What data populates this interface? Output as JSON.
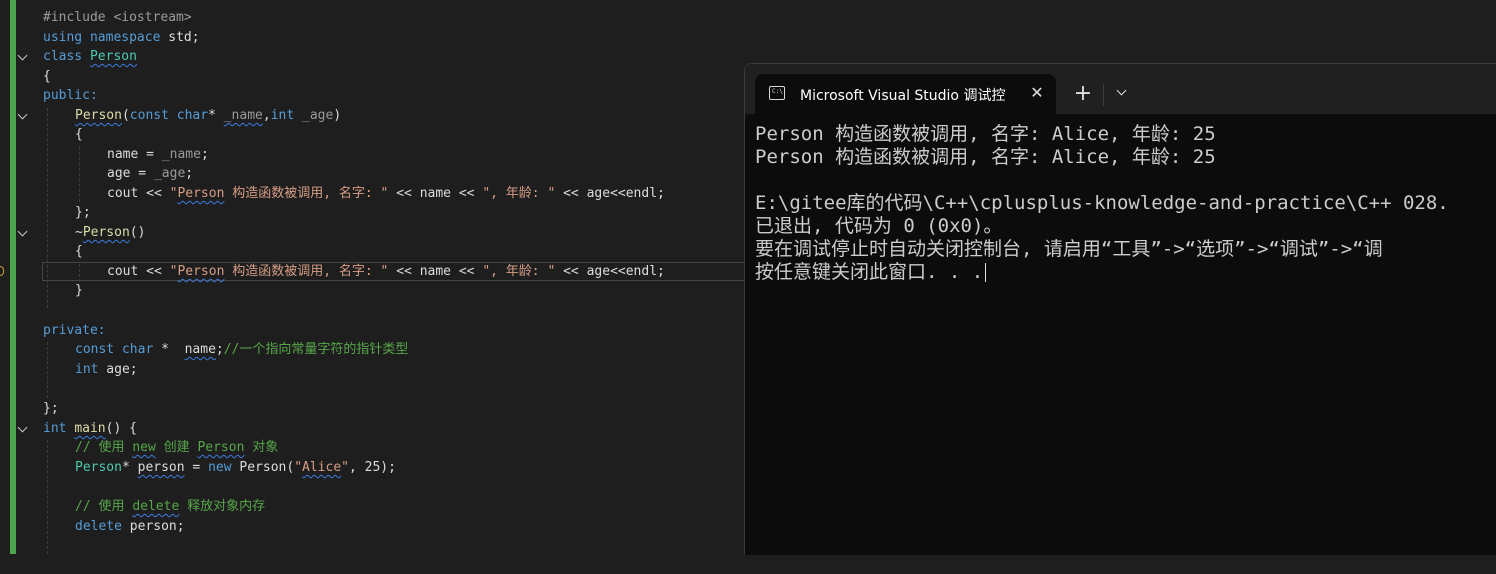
{
  "editor": {
    "lines": {
      "l1": "#include <iostream>",
      "l2a": "using",
      "l2b": " namespace",
      "l2c": " std;",
      "l3a": "class",
      "l3b": "Person",
      "l4": "{",
      "l5": "public:",
      "l6a": "Person",
      "l6b": "(",
      "l6c": "const char",
      "l6d": "* ",
      "l6e": "_name",
      "l6f": ",",
      "l6g": "int",
      "l6h": " _age",
      "l6i": ")",
      "l7": "{",
      "l8a": "name = ",
      "l8b": "_name",
      "l8c": ";",
      "l9a": "age = ",
      "l9b": "_age",
      "l9c": ";",
      "l10a": "cout << ",
      "l10b": "\"",
      "l10c": "Person",
      "l10d": " 构造函数被调用, 名字: \"",
      "l10e": " << name << ",
      "l10f": "\", 年龄: \"",
      "l10g": " << age<<endl;",
      "l11": "};",
      "l12a": "~",
      "l12b": "Person",
      "l12c": "()",
      "l13": "{",
      "l14a": "cout << ",
      "l14b": "\"",
      "l14c": "Person",
      "l14d": " 构造函数被调用, 名字: \"",
      "l14e": " << name << ",
      "l14f": "\", 年龄: \"",
      "l14g": " << age<<endl;",
      "l15": "}",
      "l17": "private:",
      "l18a": "const char",
      "l18b": " *  ",
      "l18c": "name",
      "l18d": ";",
      "l18e": "//一个指向常量字符的指针类型",
      "l19a": "int",
      "l19b": " age;",
      "l21": "};",
      "l22a": "int",
      "l22b": "main",
      "l22c": "() {",
      "l23a": "// 使用 ",
      "l23b": "new",
      "l23c": " 创建 ",
      "l23d": "Person",
      "l23e": " 对象",
      "l24a": "Person",
      "l24b": "* ",
      "l24c": "person",
      "l24d": " = ",
      "l24e": "new",
      "l24f": " Person(",
      "l24g": "\"",
      "l24h": "Alice",
      "l24i": "\"",
      "l24j": ", 25);",
      "l26a": "// 使用 ",
      "l26b": "delete",
      "l26c": " 释放对象内存",
      "l27a": "delete",
      "l27b": " person;"
    }
  },
  "console": {
    "tab_title": "Microsoft Visual Studio 调试控",
    "tab_icon_glyph": "C:\\",
    "close_glyph": "✕",
    "new_tab_glyph": "+",
    "output": {
      "line1": "Person 构造函数被调用, 名字: Alice, 年龄: 25",
      "line2": "Person 构造函数被调用, 名字: Alice, 年龄: 25",
      "line4": "E:\\gitee库的代码\\C++\\cplusplus-knowledge-and-practice\\C++ 028.",
      "line5": "已退出, 代码为 0 (0x0)。",
      "line6": "要在调试停止时自动关闭控制台, 请启用“工具”->“选项”->“调试”->“调",
      "line7": "按任意键关闭此窗口. . ."
    }
  },
  "colors": {
    "editor_bg": "#1e1e1e",
    "keyword": "#569cd6",
    "string": "#d69d85",
    "comment": "#57a64a",
    "type": "#4ec9b0",
    "function": "#dcdcaa",
    "change_bar": "#4da64d",
    "console_bg": "#0c0c0c"
  }
}
